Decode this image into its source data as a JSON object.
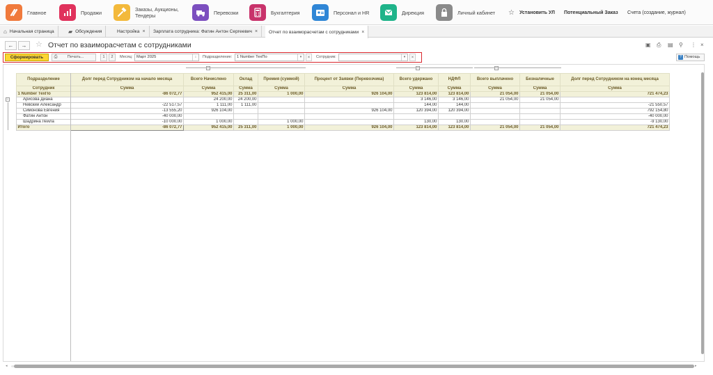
{
  "sections": [
    {
      "label": "Главное",
      "icon": "logo-icon",
      "color": "#f07a3c"
    },
    {
      "label": "Продажи",
      "icon": "sales-chart-icon",
      "color": "#e0325c"
    },
    {
      "label": "Заказы, Аукционы, Тендеры",
      "icon": "gavel-icon",
      "color": "#f3b93b"
    },
    {
      "label": "Перевозки",
      "icon": "truck-icon",
      "color": "#7c4fbf"
    },
    {
      "label": "Бухгалтерия",
      "icon": "calculator-icon",
      "color": "#c8336b"
    },
    {
      "label": "Персонал и HR",
      "icon": "id-card-icon",
      "color": "#2f86d6"
    },
    {
      "label": "Дирекция",
      "icon": "mail-icon",
      "color": "#1fb48a"
    },
    {
      "label": "Личный кабинет",
      "icon": "lock-icon",
      "color": "#8a8a8a"
    }
  ],
  "top_links": {
    "install_ul": "Установить УЛ",
    "potential_order": "Потенциальный Заказ",
    "accounts": "Счета (создание, журнал)"
  },
  "window_tabs": [
    {
      "label": "Начальная страница",
      "icon": "home-icon",
      "closable": false
    },
    {
      "label": "Обсуждения",
      "icon": "chat-icon",
      "closable": false
    },
    {
      "label": "Настройка",
      "closable": true
    },
    {
      "label": "Зарплата сотрудника: Фатин Антон Сергеевич",
      "closable": true
    },
    {
      "label": "Отчет по взаиморасчетам с сотрудниками",
      "closable": true,
      "active": true
    }
  ],
  "form": {
    "title": "Отчет по взаиморасчетам с сотрудниками",
    "generate_label": "Сформировать",
    "print_label": "Печать...",
    "page_1": "1",
    "page_2": "2",
    "month_label": "Месяц:",
    "month_value": "Март 2025",
    "dept_label": "Подразделение:",
    "dept_value": "1 Number ТехПо",
    "employee_label": "Сотрудник:",
    "employee_value": "",
    "help_label": "Помощь"
  },
  "report": {
    "header_row1": {
      "dept": "Подразделение",
      "debt_start": "Долг перед Сотрудником на начало месяца",
      "accrued": "Всего Начислено",
      "salary": "Оклад",
      "bonus": "Премия (суммой)",
      "percent": "Процент от Заявки (Перевозчика)",
      "withheld": "Всего удержано",
      "ndfl": "НДФЛ",
      "paid": "Всего выплачено",
      "cashless": "Безналичные",
      "debt_end": "Долг перед Сотрудником на конец месяца"
    },
    "header_row2": {
      "employee": "Сотрудник",
      "sum": "Сумма"
    },
    "group": {
      "name": "1 Number ТехПо",
      "debt_start": "-86 072,77",
      "accrued": "952 415,00",
      "salary": "25 311,00",
      "bonus": "1 000,00",
      "percent": "926 104,00",
      "withheld": "123 814,00",
      "ndfl": "123 814,00",
      "paid": "21 054,00",
      "cashless": "21 054,00",
      "debt_end": "721 474,23"
    },
    "rows": [
      {
        "name": "Арисова Диана",
        "debt_start": "",
        "accrued": "24 200,00",
        "salary": "24 200,00",
        "bonus": "",
        "percent": "",
        "withheld": "3 146,00",
        "ndfl": "3 146,00",
        "paid": "21 054,00",
        "cashless": "21 054,00",
        "debt_end": ""
      },
      {
        "name": "Невский Александр",
        "debt_start": "-22 517,57",
        "accrued": "1 111,00",
        "salary": "1 111,00",
        "bonus": "",
        "percent": "",
        "withheld": "144,00",
        "ndfl": "144,00",
        "paid": "",
        "cashless": "",
        "debt_end": "-21 550,57"
      },
      {
        "name": "Симонова Евгения",
        "debt_start": "-13 555,20",
        "accrued": "926 104,00",
        "salary": "",
        "bonus": "",
        "percent": "926 104,00",
        "withheld": "120 394,00",
        "ndfl": "120 394,00",
        "paid": "",
        "cashless": "",
        "debt_end": "792 154,80"
      },
      {
        "name": "Фатин Антон",
        "debt_start": "-40 000,00",
        "accrued": "",
        "salary": "",
        "bonus": "",
        "percent": "",
        "withheld": "",
        "ndfl": "",
        "paid": "",
        "cashless": "",
        "debt_end": "-40 000,00"
      },
      {
        "name": "Шадрина Лейла",
        "debt_start": "-10 000,00",
        "accrued": "1 000,00",
        "salary": "",
        "bonus": "1 000,00",
        "percent": "",
        "withheld": "130,00",
        "ndfl": "130,00",
        "paid": "",
        "cashless": "",
        "debt_end": "-9 130,00"
      }
    ],
    "total": {
      "name": "Итого",
      "debt_start": "-86 072,77",
      "accrued": "952 415,00",
      "salary": "25 311,00",
      "bonus": "1 000,00",
      "percent": "926 104,00",
      "withheld": "123 814,00",
      "ndfl": "123 814,00",
      "paid": "21 054,00",
      "cashless": "21 054,00",
      "debt_end": "721 474,23"
    }
  }
}
